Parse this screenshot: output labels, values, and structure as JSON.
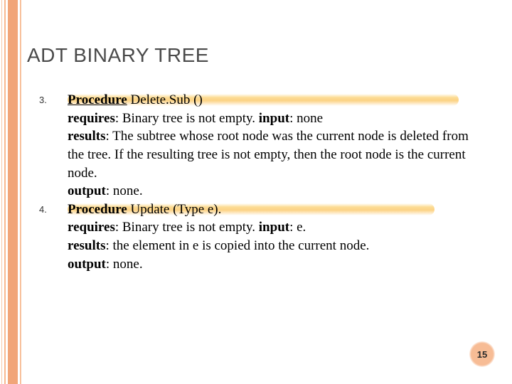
{
  "title": "ADT BINARY TREE",
  "items": [
    {
      "num": "3.",
      "proc_label": "Procedure",
      "proc_name": " Delete.Sub ()",
      "requires_label": "requires",
      "requires_text": ": Binary tree is not empty. ",
      "input_label": "input",
      "input_text": ": none",
      "results_label": "results",
      "results_text": ": The subtree whose root node was the current node is deleted from the tree. If the resulting tree is not empty, then the root node is the current node.",
      "output_label": "output",
      "output_text": ": none."
    },
    {
      "num": "4.",
      "proc_label": "Procedure",
      "proc_name": " Update (Type e).",
      "requires_label": "requires",
      "requires_text": ": Binary tree is not empty. ",
      "input_label": "input",
      "input_text": ":  e.",
      "results_label": "results",
      "results_text": ": the element in e is copied into the current node.",
      "output_label": "output",
      "output_text": ": none."
    }
  ],
  "page_number": "15"
}
